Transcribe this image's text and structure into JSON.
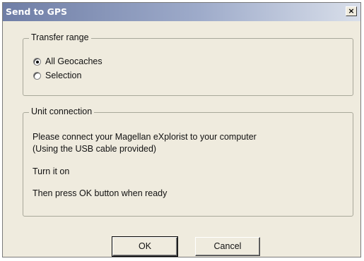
{
  "window": {
    "title": "Send to GPS",
    "close_label": "×"
  },
  "transfer_range": {
    "legend": "Transfer range",
    "options": [
      {
        "label": "All Geocaches",
        "checked": true
      },
      {
        "label": "Selection",
        "checked": false
      }
    ]
  },
  "unit_connection": {
    "legend": "Unit connection",
    "lines": [
      "Please connect your Magellan eXplorist to your computer",
      "(Using the USB cable provided)",
      "Turn it on",
      "Then press OK button when ready"
    ]
  },
  "buttons": {
    "ok_label": "OK",
    "cancel_label": "Cancel"
  },
  "colors": {
    "title_bar_start": "#6f7ea6",
    "title_bar_end": "#d9dfea",
    "dialog_face": "#efebde"
  }
}
